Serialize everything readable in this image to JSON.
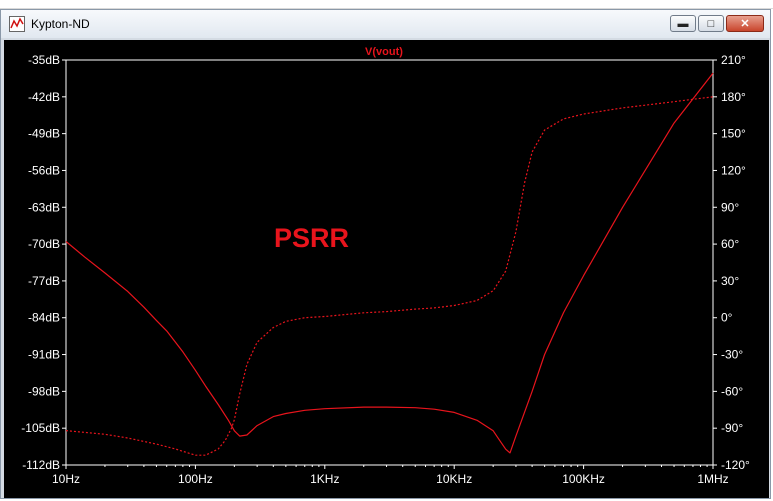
{
  "window": {
    "title": "Kypton-ND",
    "icons": {
      "app": "waveform-icon",
      "minimize": "minimize-icon",
      "maximize": "maximize-icon",
      "close": "close-icon"
    }
  },
  "annotation": {
    "text": "PSRR",
    "color": "#e8141c"
  },
  "colors": {
    "trace": "#e8141c",
    "axis_text": "#ffffff",
    "background": "#000000",
    "frame": "#ffffff"
  },
  "chart_data": {
    "type": "line",
    "title": "V(vout)",
    "x_scale": "log",
    "xlim": [
      10,
      1000000
    ],
    "x_ticks": [
      {
        "value": 10,
        "label": "10Hz"
      },
      {
        "value": 100,
        "label": "100Hz"
      },
      {
        "value": 1000,
        "label": "1KHz"
      },
      {
        "value": 10000,
        "label": "10KHz"
      },
      {
        "value": 100000,
        "label": "100KHz"
      },
      {
        "value": 1000000,
        "label": "1MHz"
      }
    ],
    "ylim_left": [
      -112,
      -35
    ],
    "left_ticks": [
      {
        "value": -35,
        "label": "-35dB"
      },
      {
        "value": -42,
        "label": "-42dB"
      },
      {
        "value": -49,
        "label": "-49dB"
      },
      {
        "value": -56,
        "label": "-56dB"
      },
      {
        "value": -63,
        "label": "-63dB"
      },
      {
        "value": -70,
        "label": "-70dB"
      },
      {
        "value": -77,
        "label": "-77dB"
      },
      {
        "value": -84,
        "label": "-84dB"
      },
      {
        "value": -91,
        "label": "-91dB"
      },
      {
        "value": -98,
        "label": "-98dB"
      },
      {
        "value": -105,
        "label": "-105dB"
      },
      {
        "value": -112,
        "label": "-112dB"
      }
    ],
    "ylim_right": [
      -120,
      210
    ],
    "right_ticks": [
      {
        "value": 210,
        "label": "210°"
      },
      {
        "value": 180,
        "label": "180°"
      },
      {
        "value": 150,
        "label": "150°"
      },
      {
        "value": 120,
        "label": "120°"
      },
      {
        "value": 90,
        "label": "90°"
      },
      {
        "value": 60,
        "label": "60°"
      },
      {
        "value": 30,
        "label": "30°"
      },
      {
        "value": 0,
        "label": "0°"
      },
      {
        "value": -30,
        "label": "-30°"
      },
      {
        "value": -60,
        "label": "-60°"
      },
      {
        "value": -90,
        "label": "-90°"
      },
      {
        "value": -120,
        "label": "-120°"
      }
    ],
    "grid": false,
    "series": [
      {
        "name": "V(vout)",
        "quantity": "magnitude",
        "axis": "left",
        "style": "solid",
        "x": [
          10,
          14,
          20,
          30,
          40,
          50,
          60,
          80,
          100,
          120,
          150,
          180,
          200,
          220,
          250,
          300,
          400,
          500,
          700,
          1000,
          2000,
          3000,
          5000,
          7000,
          10000,
          15000,
          20000,
          22000,
          25000,
          27000,
          30000,
          40000,
          50000,
          70000,
          100000,
          200000,
          500000,
          1000000
        ],
        "y": [
          -69.5,
          -72.5,
          -75.5,
          -79.0,
          -82.0,
          -84.5,
          -86.5,
          -90.5,
          -94.0,
          -97.0,
          -100.5,
          -103.5,
          -105.5,
          -106.5,
          -106.3,
          -104.5,
          -102.8,
          -102.2,
          -101.6,
          -101.3,
          -101.0,
          -101.0,
          -101.1,
          -101.4,
          -102.0,
          -103.5,
          -105.5,
          -107.0,
          -109.0,
          -109.7,
          -106.5,
          -98.0,
          -91.0,
          -83.0,
          -76.0,
          -63.0,
          -47.0,
          -37.5
        ]
      },
      {
        "name": "V(vout)",
        "quantity": "phase",
        "axis": "right",
        "style": "dashed",
        "x": [
          10,
          20,
          30,
          50,
          70,
          100,
          120,
          150,
          170,
          190,
          200,
          220,
          250,
          300,
          400,
          500,
          700,
          1000,
          2000,
          3000,
          5000,
          7000,
          10000,
          15000,
          20000,
          25000,
          30000,
          35000,
          40000,
          50000,
          70000,
          100000,
          200000,
          500000,
          1000000
        ],
        "y": [
          -92,
          -95,
          -98,
          -103,
          -107,
          -112,
          -112,
          -107,
          -100,
          -90,
          -83,
          -62,
          -38,
          -20,
          -8,
          -3,
          0,
          1,
          4,
          5,
          7,
          8,
          10,
          14,
          22,
          38,
          70,
          110,
          135,
          153,
          162,
          166,
          171,
          176,
          180
        ]
      }
    ]
  }
}
